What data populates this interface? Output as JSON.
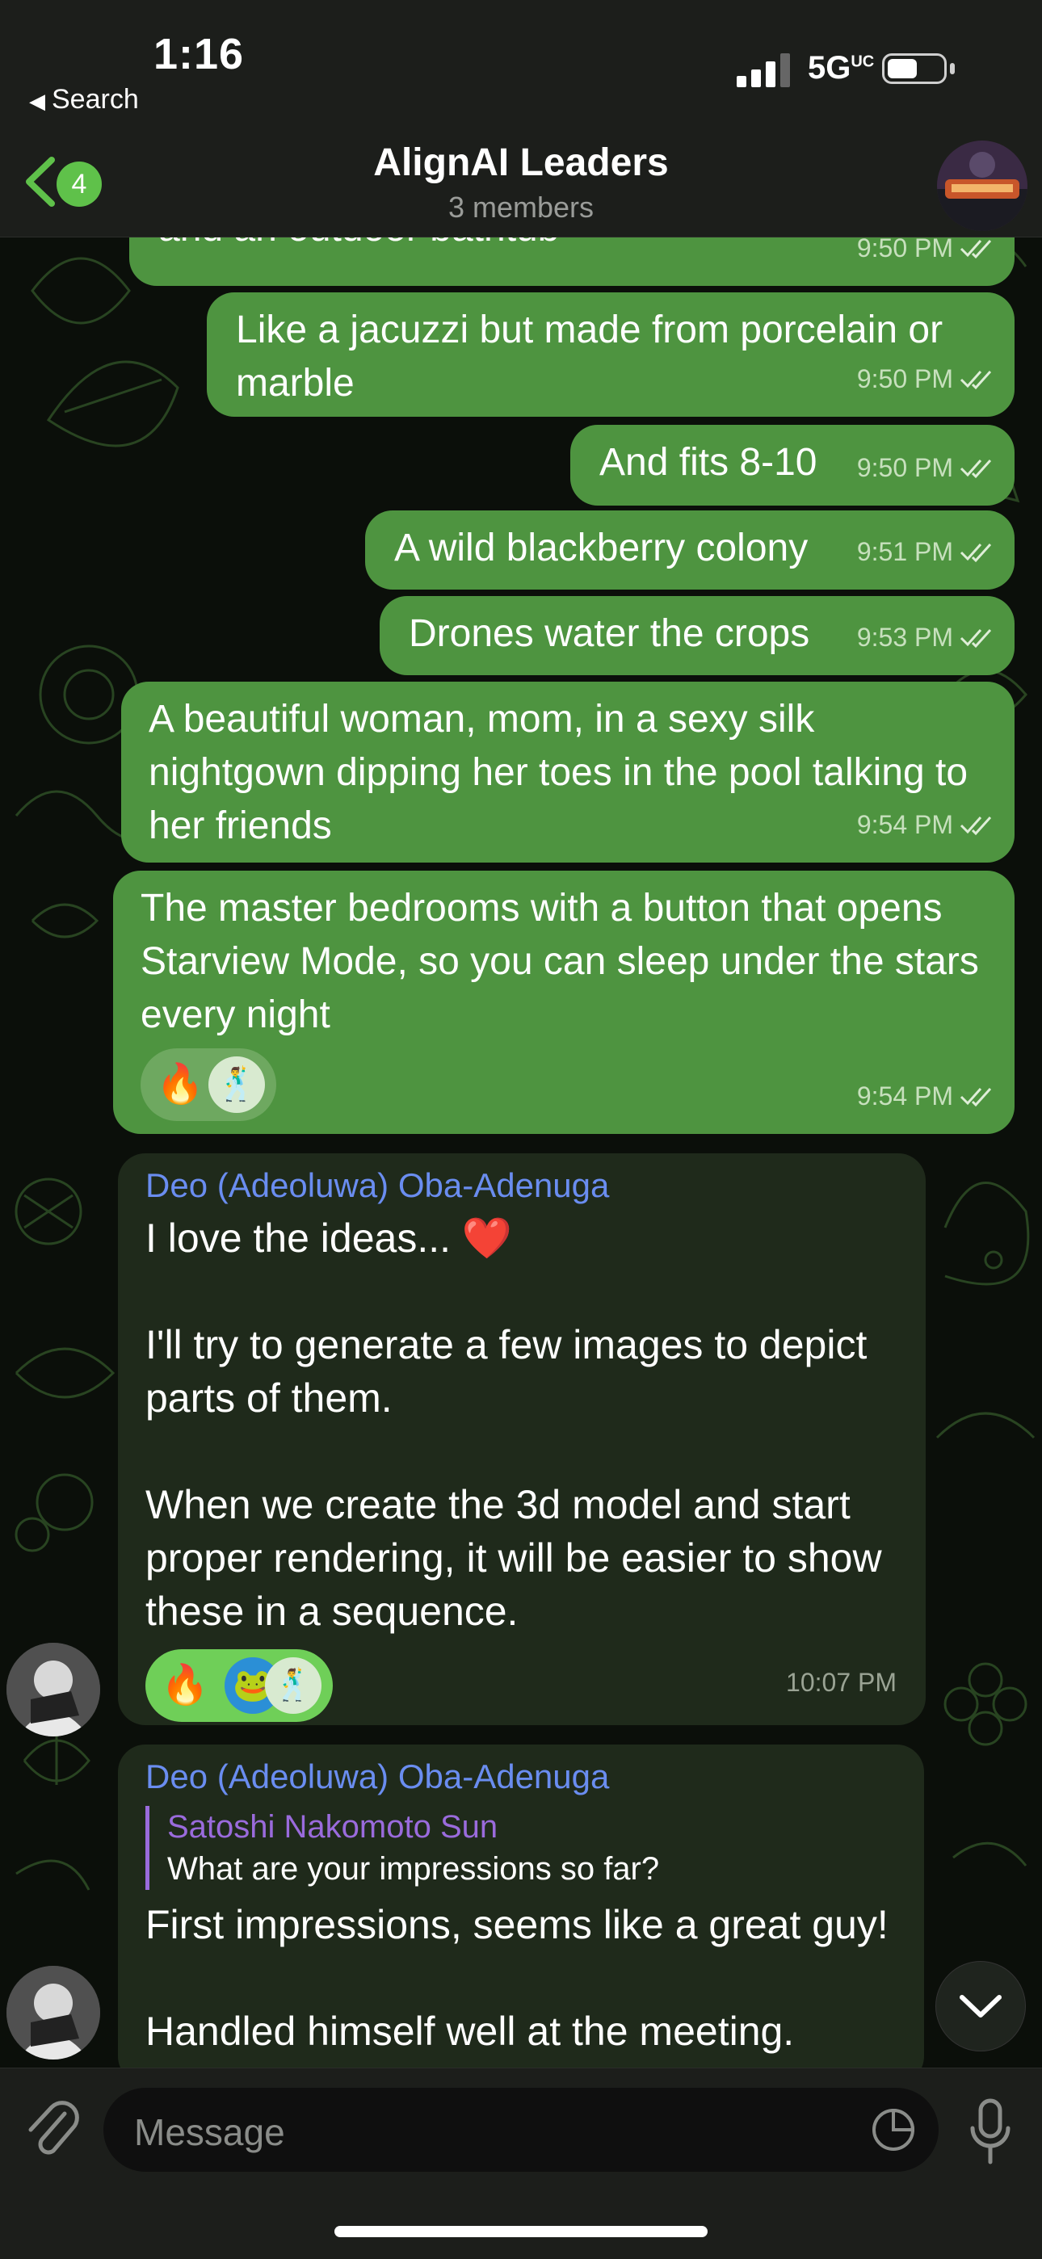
{
  "status": {
    "time": "1:16",
    "back_label": "Search",
    "network": "5G",
    "network_sup": "UC"
  },
  "header": {
    "unread_count": "4",
    "title": "AlignAI Leaders",
    "subtitle": "3 members"
  },
  "messages": {
    "m1": {
      "text": "and an outdoor bathtub",
      "time": "9:50 PM"
    },
    "m2": {
      "text": "Like a jacuzzi but made from porcelain or marble",
      "time": "9:50 PM"
    },
    "m3": {
      "text": "And fits 8-10",
      "time": "9:50 PM"
    },
    "m4": {
      "text": "A wild blackberry colony",
      "time": "9:51 PM"
    },
    "m5": {
      "text": "Drones water the crops",
      "time": "9:53 PM"
    },
    "m6": {
      "text": "A beautiful woman, mom, in a sexy silk nightgown dipping her toes in the pool talking to her friends",
      "time": "9:54 PM"
    },
    "m7": {
      "text": "The master bedrooms with a button that opens Starview Mode, so you can sleep under the stars every night",
      "time": "9:54 PM",
      "reactions": [
        "🔥",
        "🕺"
      ]
    },
    "m8": {
      "sender": "Deo (Adeoluwa) Oba-Adenuga",
      "p1": "I love the ideas... ❤️",
      "p2": "I'll try to generate a few images to depict parts of them.",
      "p3": "When we create the 3d model and start proper rendering, it will be easier to show these in a sequence.",
      "time": "10:07 PM",
      "reactions": [
        "🔥",
        "🐸",
        "🕺"
      ]
    },
    "m9": {
      "sender": "Deo (Adeoluwa) Oba-Adenuga",
      "reply_name": "Satoshi Nakomoto Sun",
      "reply_text": "What are your impressions so far?",
      "p1": "First impressions, seems like a great guy!",
      "p2": "Handled himself well at the meeting."
    }
  },
  "input": {
    "placeholder": "Message"
  },
  "colors": {
    "outgoing": "#4e9440",
    "incoming": "#1f2a1b",
    "accent": "#5fc14a",
    "sender": "#6a8df0"
  }
}
